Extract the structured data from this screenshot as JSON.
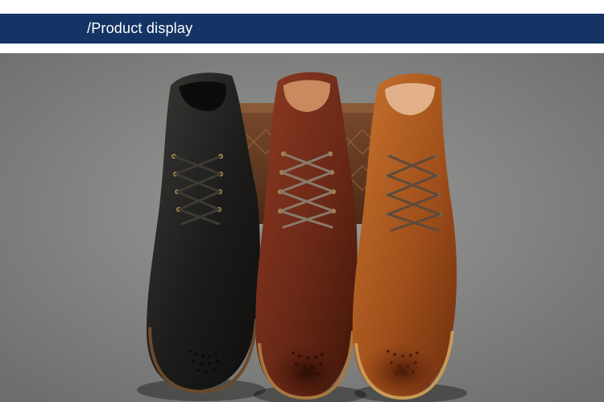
{
  "banner": {
    "title": "/Product display",
    "background_color": "#153364",
    "text_color": "#ffffff"
  },
  "photo": {
    "subject": "three lace-up leather brogue ankle boots on a wooden box",
    "boots": [
      {
        "color_name": "black",
        "color": "#1f1e1d"
      },
      {
        "color_name": "reddish brown",
        "color": "#6d2a1a"
      },
      {
        "color_name": "tan",
        "color": "#a8561f"
      }
    ]
  }
}
